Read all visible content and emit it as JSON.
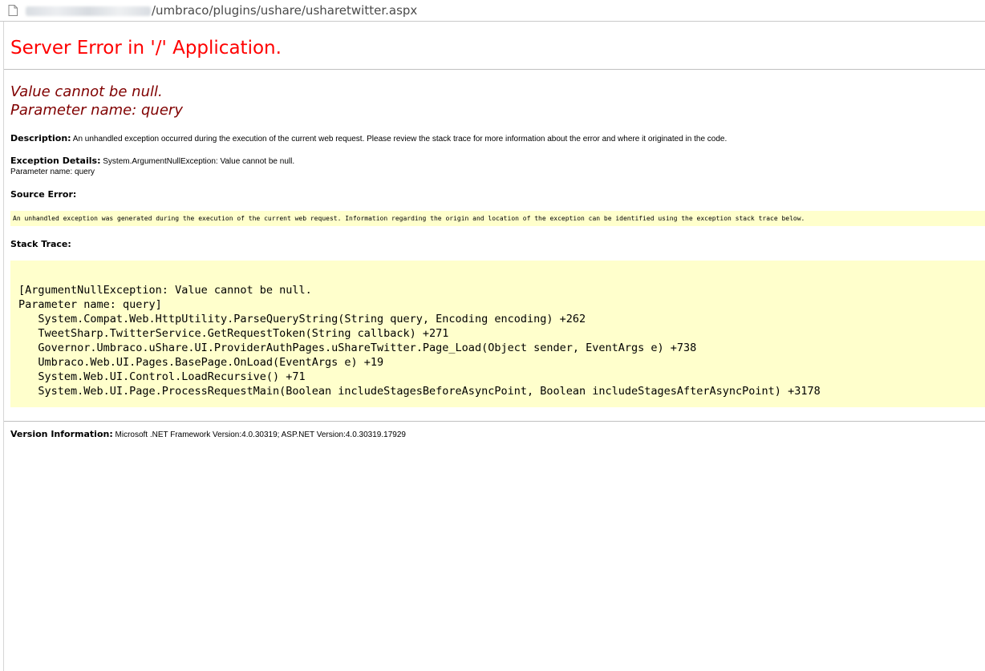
{
  "address_bar": {
    "path": "/umbraco/plugins/ushare/usharetwitter.aspx"
  },
  "page": {
    "title": "Server Error in '/' Application.",
    "error_message_line1": "Value cannot be null.",
    "error_message_line2": "Parameter name: query",
    "description_label": "Description:",
    "description_text": "An unhandled exception occurred during the execution of the current web request. Please review the stack trace for more information about the error and where it originated in the code.",
    "exception_label": "Exception Details:",
    "exception_text": "System.ArgumentNullException: Value cannot be null.",
    "exception_param": "Parameter name: query",
    "source_error_label": "Source Error:",
    "source_error_text": "An unhandled exception was generated during the execution of the current web request. Information regarding the origin and location of the exception can be identified using the exception stack trace below.",
    "stack_trace_label": "Stack Trace:",
    "stack_trace_lines": [
      "[ArgumentNullException: Value cannot be null.",
      "Parameter name: query]",
      "   System.Compat.Web.HttpUtility.ParseQueryString(String query, Encoding encoding) +262",
      "   TweetSharp.TwitterService.GetRequestToken(String callback) +271",
      "   Governor.Umbraco.uShare.UI.ProviderAuthPages.uShareTwitter.Page_Load(Object sender, EventArgs e) +738",
      "   Umbraco.Web.UI.Pages.BasePage.OnLoad(EventArgs e) +19",
      "   System.Web.UI.Control.LoadRecursive() +71",
      "   System.Web.UI.Page.ProcessRequestMain(Boolean includeStagesBeforeAsyncPoint, Boolean includeStagesAfterAsyncPoint) +3178"
    ],
    "version_label": "Version Information:",
    "version_text": "Microsoft .NET Framework Version:4.0.30319; ASP.NET Version:4.0.30319.17929"
  },
  "icons": {
    "page": "document-icon"
  },
  "colors": {
    "title": "#ff0000",
    "message": "#800000",
    "code_bg": "#ffffcc"
  }
}
